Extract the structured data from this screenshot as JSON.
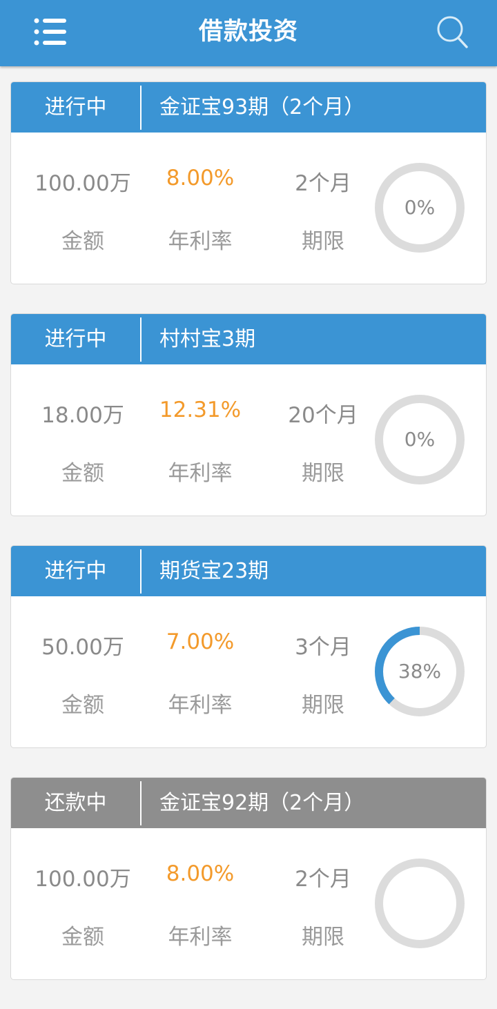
{
  "appbar": {
    "title": "借款投资",
    "menu_icon": "list-menu-icon",
    "search_icon": "search-icon"
  },
  "colors": {
    "primary": "#3b94d4",
    "accent_rate": "#f39a2b",
    "repaying_header": "#8e8e8e",
    "ring_track": "#dcdcdc"
  },
  "labels": {
    "amount": "金额",
    "rate": "年利率",
    "term": "期限"
  },
  "loans": [
    {
      "status": "进行中",
      "status_type": "active",
      "name": "金证宝93期（2个月）",
      "amount": "100.00万",
      "rate": "8.00%",
      "term": "2个月",
      "progress": 0,
      "progress_label": "0%"
    },
    {
      "status": "进行中",
      "status_type": "active",
      "name": "村村宝3期",
      "amount": "18.00万",
      "rate": "12.31%",
      "term": "20个月",
      "progress": 0,
      "progress_label": "0%"
    },
    {
      "status": "进行中",
      "status_type": "active",
      "name": "期货宝23期",
      "amount": "50.00万",
      "rate": "7.00%",
      "term": "3个月",
      "progress": 38,
      "progress_label": "38%"
    },
    {
      "status": "还款中",
      "status_type": "repaying",
      "name": "金证宝92期（2个月）",
      "amount": "100.00万",
      "rate": "8.00%",
      "term": "2个月",
      "progress": 0,
      "progress_label": ""
    }
  ]
}
